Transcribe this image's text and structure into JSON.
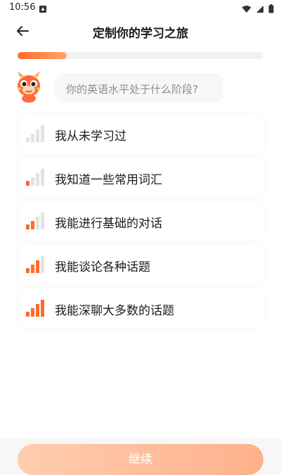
{
  "status_bar": {
    "time": "10:56",
    "icons": [
      "notification-icon",
      "wifi-icon",
      "cellular-icon",
      "battery-icon"
    ]
  },
  "header": {
    "title": "定制你的学习之旅",
    "back_icon": "arrow-left-icon"
  },
  "progress": {
    "fraction": 0.2,
    "color": "#ff6b2a"
  },
  "prompt": {
    "mascot_icon": "dragon-mascot-icon",
    "question": "你的英语水平处于什么阶段?"
  },
  "options": [
    {
      "label": "我从未学习过",
      "level": 0
    },
    {
      "label": "我知道一些常用词汇",
      "level": 1
    },
    {
      "label": "我能进行基础的对话",
      "level": 2
    },
    {
      "label": "我能谈论各种话题",
      "level": 3
    },
    {
      "label": "我能深聊大多数的话题",
      "level": 4
    }
  ],
  "footer": {
    "continue_label": "继续"
  },
  "colors": {
    "accent": "#ff6b2a",
    "bar_inactive": "#e3e3e3",
    "button_gradient_start": "#ffcdb0",
    "button_gradient_end": "#ffb08b"
  }
}
